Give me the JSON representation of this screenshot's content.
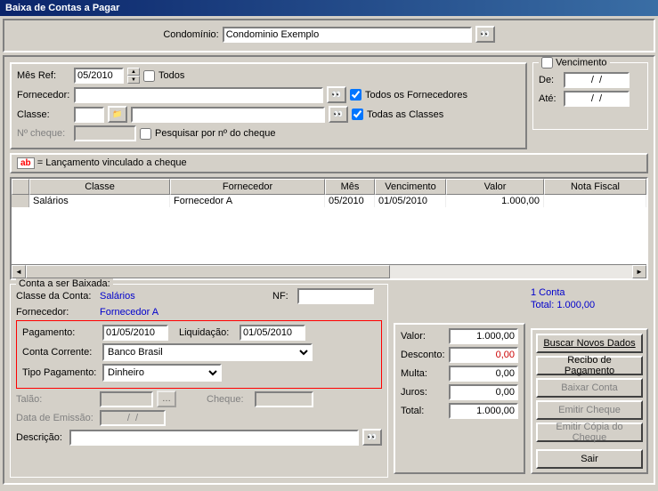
{
  "window": {
    "title": "Baixa de Contas a Pagar"
  },
  "topbar": {
    "condominio_label": "Condomínio:",
    "condominio_value": "Condominio Exemplo"
  },
  "filters": {
    "mes_ref_label": "Mês Ref:",
    "mes_ref_value": "05/2010",
    "todos_label": "Todos",
    "fornecedor_label": "Fornecedor:",
    "fornecedor_value": "",
    "classe_label": "Classe:",
    "classe_value": "",
    "no_cheque_label": "Nº cheque:",
    "no_cheque_value": "",
    "pesquisar_cheque_label": "Pesquisar por nº do cheque",
    "todos_fornecedores_label": "Todos os Fornecedores",
    "todas_classes_label": "Todas as Classes"
  },
  "vencimento": {
    "legend": "Vencimento",
    "de_label": "De:",
    "de_value": "/  /",
    "ate_label": "Até:",
    "ate_value": "/  /"
  },
  "ab_note": "= Lançamento vinculado a cheque",
  "grid": {
    "headers": [
      "",
      "Classe",
      "Fornecedor",
      "Mês",
      "Vencimento",
      "Valor",
      "Nota Fiscal"
    ],
    "rows": [
      {
        "marker": "",
        "classe": "Salários",
        "fornecedor": "Fornecedor A",
        "mes": "05/2010",
        "vencimento": "01/05/2010",
        "valor": "1.000,00",
        "nf": ""
      }
    ]
  },
  "conta": {
    "legend": "Conta a ser Baixada:",
    "classe_label": "Classe da Conta:",
    "classe_value": "Salários",
    "nf_label": "NF:",
    "nf_value": "",
    "fornecedor_label": "Fornecedor:",
    "fornecedor_value": "Fornecedor A",
    "pagamento_label": "Pagamento:",
    "pagamento_value": "01/05/2010",
    "liquidacao_label": "Liquidação:",
    "liquidacao_value": "01/05/2010",
    "conta_corrente_label": "Conta Corrente:",
    "conta_corrente_value": "Banco Brasil",
    "tipo_pagamento_label": "Tipo Pagamento:",
    "tipo_pagamento_value": "Dinheiro",
    "talao_label": "Talão:",
    "talao_value": "",
    "cheque_label": "Cheque:",
    "cheque_value": "",
    "data_emissao_label": "Data de Emissão:",
    "data_emissao_value": "/  /",
    "descricao_label": "Descrição:",
    "descricao_value": ""
  },
  "valores": {
    "valor_label": "Valor:",
    "valor_value": "1.000,00",
    "desconto_label": "Desconto:",
    "desconto_value": "0,00",
    "multa_label": "Multa:",
    "multa_value": "0,00",
    "juros_label": "Juros:",
    "juros_value": "0,00",
    "total_label": "Total:",
    "total_value": "1.000,00"
  },
  "summary": {
    "count": "1 Conta",
    "total": "Total: 1.000,00"
  },
  "buttons": {
    "buscar": "Buscar Novos Dados",
    "recibo": "Recibo de Pagamento",
    "baixar": "Baixar Conta",
    "emitir_cheque": "Emitir Cheque",
    "emitir_copia": "Emitir Cópia do Cheque",
    "sair": "Sair"
  },
  "col_widths": {
    "marker": 20,
    "classe": 158,
    "fornecedor": 174,
    "mes": 56,
    "vencimento": 80,
    "valor": 110,
    "nf": 92
  }
}
